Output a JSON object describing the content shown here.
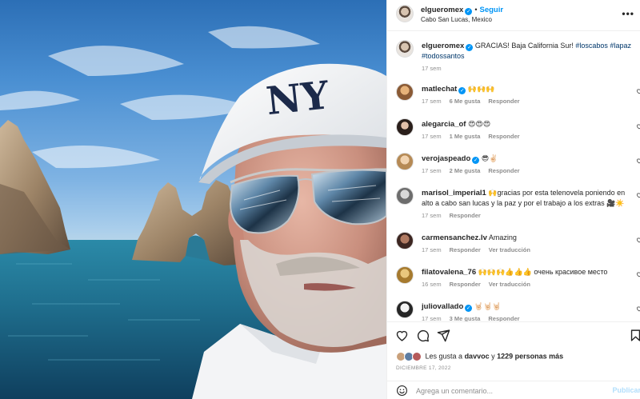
{
  "post": {
    "author": "elgueromex",
    "follow_label": "Seguir",
    "location": "Cabo San Lucas, Mexico",
    "more_label": "•••",
    "caption_user": "elgueromex",
    "caption_text": "GRACIAS! Baja California Sur! ",
    "caption_tags": "#loscabos #lapaz #todossantos",
    "caption_age": "17 sem"
  },
  "comments": [
    {
      "user": "matlechat",
      "verified": true,
      "text": "🙌🙌🙌",
      "age": "17 sem",
      "likes": "6 Me gusta",
      "action": "Responder",
      "avatar_color": "#c68e5a"
    },
    {
      "user": "alegarcia_of",
      "verified": false,
      "text": "😍😍😍",
      "age": "17 sem",
      "likes": "1 Me gusta",
      "action": "Responder",
      "avatar_color": "#3b2f2a"
    },
    {
      "user": "verojaspeado",
      "verified": true,
      "text": "😎✌🏻",
      "age": "17 sem",
      "likes": "2 Me gusta",
      "action": "Responder",
      "avatar_color": "#d8b58a"
    },
    {
      "user": "marisol_imperial1",
      "verified": false,
      "text": "🙌gracias por esta telenovela poniendo en alto a cabo san lucas y la paz y por el trabajo a los extras 🎥☀️",
      "age": "17 sem",
      "likes": "",
      "action": "Responder",
      "avatar_color": "#8a8a8a"
    },
    {
      "user": "carmensanchez.lv",
      "verified": false,
      "text": "Amazing",
      "age": "17 sem",
      "likes": "",
      "action": "Responder",
      "action2": "Ver traducción",
      "avatar_color": "#5a3b33"
    },
    {
      "user": "filatovalena_76",
      "verified": false,
      "text": "🙌🙌🙌👍👍👍 очень красивое место",
      "age": "16 sem",
      "likes": "",
      "action": "Responder",
      "action2": "Ver traducción",
      "avatar_color": "#c9a054"
    },
    {
      "user": "juliovallado",
      "verified": true,
      "text": "🤘🏻🤘🏻🤘🏻",
      "age": "17 sem",
      "likes": "3 Me gusta",
      "action": "Responder",
      "avatar_color": "#262626"
    }
  ],
  "likes": {
    "prefix": "Les gusta a ",
    "user": "davvoc",
    "middle": " y ",
    "count": "1229 personas más"
  },
  "date": "DICIEMBRE 17, 2022",
  "add_comment": {
    "placeholder": "Agrega un comentario...",
    "publish_label": "Publicar"
  },
  "photo": {
    "cap_logo": "NY"
  }
}
